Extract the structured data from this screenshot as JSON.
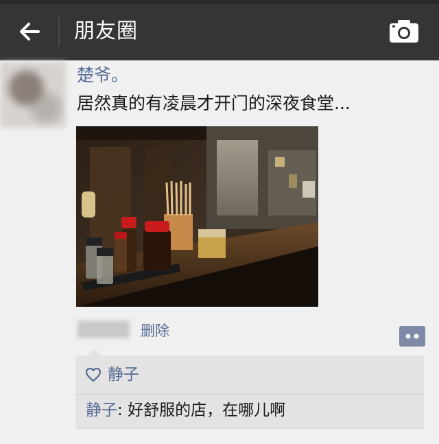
{
  "header": {
    "title": "朋友圈",
    "back_icon": "arrow-left-icon",
    "camera_icon": "camera-icon"
  },
  "post": {
    "author": "楚爷。",
    "text": "居然真的有凌晨才开门的深夜食堂...",
    "photo_icon": "photo-image",
    "delete_label": "删除",
    "comment_icon": "comment-dots-icon"
  },
  "interactions": {
    "likes": [
      "静子"
    ],
    "like_icon": "heart-outline-icon",
    "comments": [
      {
        "author": "静子",
        "separator": ": ",
        "text": "好舒服的店，在哪儿啊"
      }
    ]
  },
  "colors": {
    "topbar": "#353535",
    "link_blue": "#576b95",
    "page_bg": "#f0f0f0",
    "comment_bg": "#e3e3e3"
  }
}
